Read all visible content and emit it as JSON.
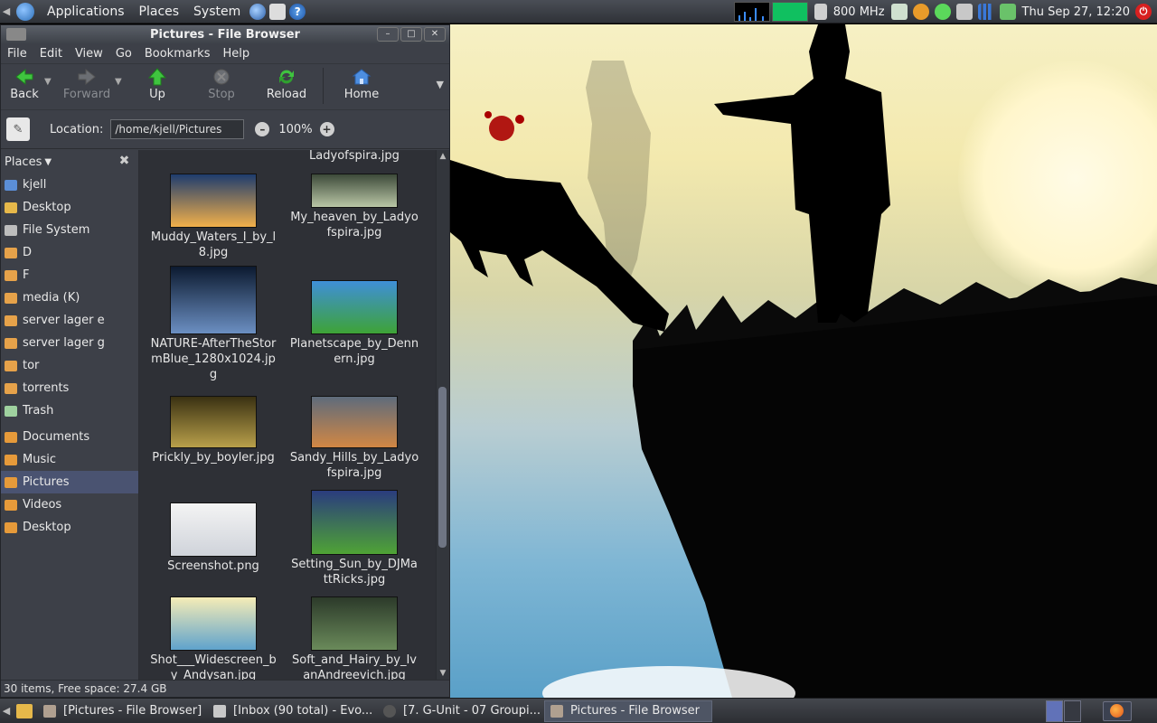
{
  "top_panel": {
    "menus": [
      "Applications",
      "Places",
      "System"
    ],
    "cpu_freq": "800 MHz",
    "clock": "Thu Sep 27, 12:20"
  },
  "window": {
    "title": "Pictures - File Browser",
    "menubar": [
      "File",
      "Edit",
      "View",
      "Go",
      "Bookmarks",
      "Help"
    ],
    "toolbar": {
      "back": "Back",
      "forward": "Forward",
      "up": "Up",
      "stop": "Stop",
      "reload": "Reload",
      "home": "Home"
    },
    "location": {
      "label": "Location:",
      "value": "/home/kjell/Pictures",
      "zoom": "100%"
    },
    "sidebar": {
      "header": "Places",
      "items": [
        "kjell",
        "Desktop",
        "File System",
        "D",
        "F",
        "media (K)",
        "server lager e",
        "server lager g",
        "tor",
        "torrents",
        "Trash"
      ],
      "bookmarks": [
        "Documents",
        "Music",
        "Pictures",
        "Videos",
        "Desktop"
      ],
      "selected": "Pictures"
    },
    "files": [
      {
        "name": "Ladyofspira.jpg",
        "colors": [
          "#222",
          "#222"
        ]
      },
      {
        "name": "Muddy_Waters_I_by_l8.jpg",
        "colors": [
          "#1e3c6e",
          "#f2b04a"
        ]
      },
      {
        "name": "My_heaven_by_Ladyofspira.jpg",
        "colors": [
          "#3d4a3a",
          "#b9c6a6"
        ]
      },
      {
        "name": "NATURE-AfterTheStormBlue_1280x1024.jpg",
        "colors": [
          "#0c1a30",
          "#6b8fc2"
        ]
      },
      {
        "name": "Planetscape_by_Dennern.jpg",
        "colors": [
          "#3f8fd8",
          "#3ea336"
        ]
      },
      {
        "name": "Prickly_by_boyler.jpg",
        "colors": [
          "#3a3112",
          "#b9a04a"
        ]
      },
      {
        "name": "Sandy_Hills_by_Ladyofspira.jpg",
        "colors": [
          "#5e6b7c",
          "#d28744"
        ]
      },
      {
        "name": "Screenshot.png",
        "colors": [
          "#f4f4f4",
          "#cfd3da"
        ]
      },
      {
        "name": "Setting_Sun_by_DJMattRicks.jpg",
        "colors": [
          "#2a3c7e",
          "#4fa335"
        ]
      },
      {
        "name": "Shot___Widescreen_by_Andysan.jpg",
        "colors": [
          "#f5ecb6",
          "#5fa3cc"
        ]
      },
      {
        "name": "Soft_and_Hairy_by_IvanAndreevich.jpg",
        "colors": [
          "#2c3a2a",
          "#6a8a5a"
        ]
      }
    ],
    "status": "30 items, Free space: 27.4 GB"
  },
  "taskbar": [
    {
      "label": "[Pictures - File Browser]",
      "active": false
    },
    {
      "label": "[Inbox (90 total) - Evo...",
      "active": false
    },
    {
      "label": "[7. G-Unit - 07 Groupi...",
      "active": false
    },
    {
      "label": "Pictures - File Browser",
      "active": true
    }
  ]
}
